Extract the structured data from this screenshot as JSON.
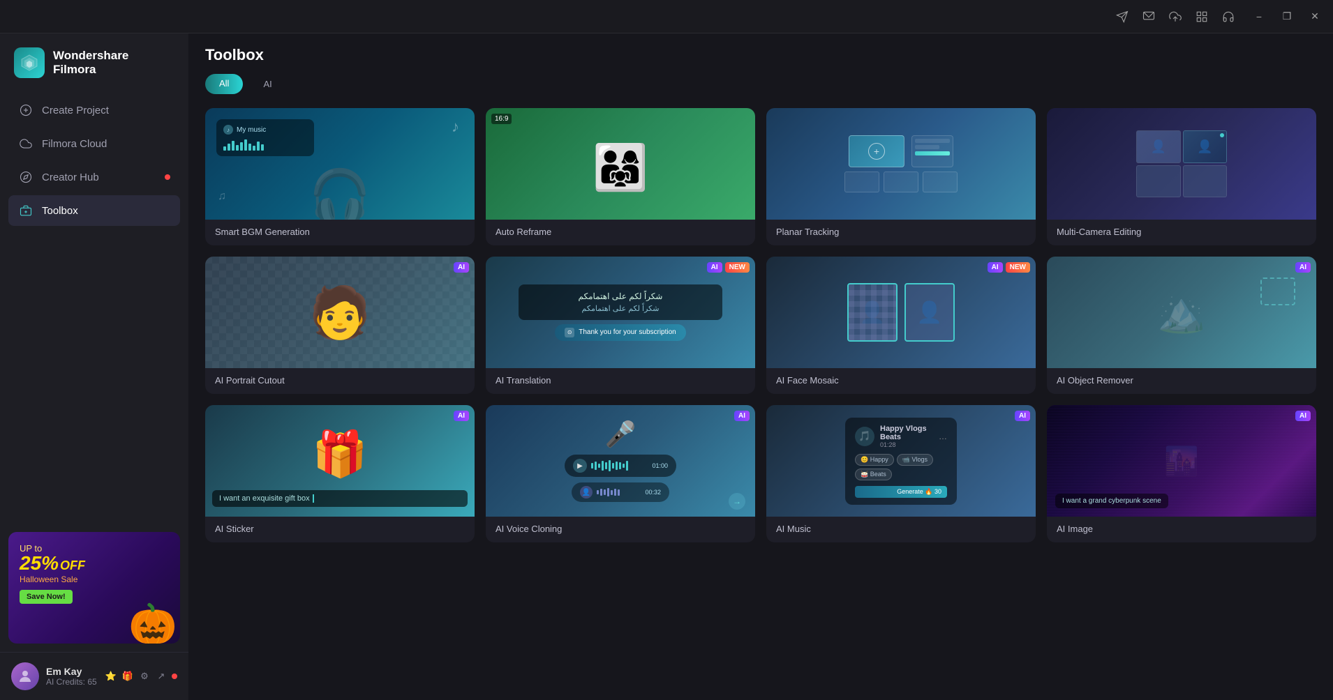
{
  "app": {
    "name": "Wondershare Filmora",
    "logo_text_line1": "Wondershare",
    "logo_text_line2": "Filmora"
  },
  "titlebar": {
    "icons": [
      "send-icon",
      "message-icon",
      "upload-icon",
      "grid-icon",
      "headset-icon"
    ],
    "minimize_label": "−",
    "restore_label": "❐",
    "close_label": "✕"
  },
  "sidebar": {
    "nav_items": [
      {
        "id": "create-project",
        "label": "Create Project",
        "icon": "plus-circle-icon",
        "active": false,
        "dot": false
      },
      {
        "id": "filmora-cloud",
        "label": "Filmora Cloud",
        "icon": "cloud-icon",
        "active": false,
        "dot": false
      },
      {
        "id": "creator-hub",
        "label": "Creator Hub",
        "icon": "compass-icon",
        "active": false,
        "dot": true
      },
      {
        "id": "toolbox",
        "label": "Toolbox",
        "icon": "toolbox-icon",
        "active": true,
        "dot": false
      }
    ],
    "promo": {
      "up_to": "UP to",
      "percent": "25%",
      "off": "OFF",
      "sale": "Halloween Sale",
      "btn": "Save Now!",
      "emoji": "🎃"
    },
    "user": {
      "name": "Em Kay",
      "credits_label": "AI Credits:",
      "credits_value": "65",
      "avatar_emoji": "👤"
    }
  },
  "main": {
    "title": "Toolbox",
    "filter_tabs": [
      {
        "id": "all",
        "label": "All",
        "active": true
      },
      {
        "id": "ai",
        "label": "AI",
        "active": false
      }
    ],
    "tools": [
      {
        "id": "smart-bgm",
        "label": "Smart BGM Generation",
        "thumb_type": "bgm",
        "badges": [],
        "aspect": ""
      },
      {
        "id": "auto-reframe",
        "label": "Auto Reframe",
        "thumb_type": "reframe",
        "badges": [],
        "aspect": "16:9"
      },
      {
        "id": "planar-tracking",
        "label": "Planar Tracking",
        "thumb_type": "planar",
        "badges": [],
        "aspect": ""
      },
      {
        "id": "multi-camera",
        "label": "Multi-Camera Editing",
        "thumb_type": "multicam",
        "badges": [],
        "aspect": ""
      },
      {
        "id": "ai-portrait",
        "label": "AI Portrait Cutout",
        "thumb_type": "portrait",
        "badges": [
          "AI"
        ],
        "aspect": ""
      },
      {
        "id": "ai-translation",
        "label": "AI Translation",
        "thumb_type": "translation",
        "badges": [
          "AI",
          "NEW"
        ],
        "aspect": ""
      },
      {
        "id": "ai-face-mosaic",
        "label": "AI Face Mosaic",
        "thumb_type": "mosaic",
        "badges": [
          "AI",
          "NEW"
        ],
        "aspect": ""
      },
      {
        "id": "ai-object-remover",
        "label": "AI Object Remover",
        "thumb_type": "objremover",
        "badges": [
          "AI"
        ],
        "aspect": ""
      },
      {
        "id": "ai-sticker",
        "label": "AI Sticker",
        "thumb_type": "sticker",
        "badges": [
          "AI"
        ],
        "aspect": "",
        "prompt": "I want an exquisite gift box"
      },
      {
        "id": "ai-voice-cloning",
        "label": "AI Voice Cloning",
        "thumb_type": "voiceclone",
        "badges": [
          "AI"
        ],
        "aspect": ""
      },
      {
        "id": "ai-music",
        "label": "AI Music",
        "thumb_type": "music",
        "badges": [
          "AI"
        ],
        "aspect": "",
        "music_title": "Happy Vlogs Beats",
        "music_time": "01:28",
        "music_tags": [
          "Happy",
          "Vlogs",
          "Beats"
        ],
        "generate_label": "Generate 🔥 30"
      },
      {
        "id": "ai-image",
        "label": "AI Image",
        "thumb_type": "aiimage",
        "badges": [
          "AI"
        ],
        "aspect": "",
        "prompt": "I want a grand cyberpunk scene"
      }
    ]
  }
}
